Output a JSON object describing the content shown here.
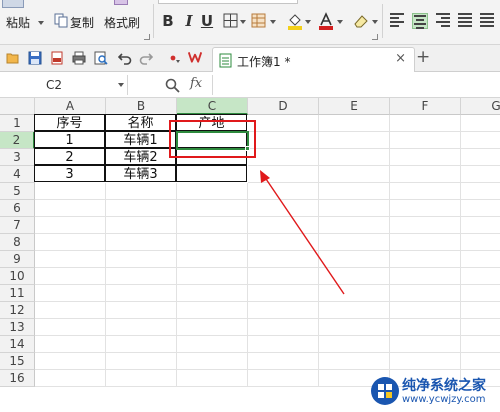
{
  "ribbon": {
    "paste_label": "粘贴",
    "copy_label": "复制",
    "format_painter_label": "格式刷",
    "bold_label": "B",
    "italic_label": "I",
    "underline_label": "U"
  },
  "tab": {
    "title": "工作簿1 *",
    "close": "×",
    "new": "+"
  },
  "formula_bar": {
    "cell_ref": "C2",
    "fx_label": "fx",
    "value": ""
  },
  "grid": {
    "columns": [
      "A",
      "B",
      "C",
      "D",
      "E",
      "F",
      "G"
    ],
    "rows": [
      "1",
      "2",
      "3",
      "4",
      "5",
      "6",
      "7",
      "8",
      "9",
      "10",
      "11",
      "12",
      "13",
      "14",
      "15",
      "16"
    ],
    "selected_column": "C",
    "selected_row": "2",
    "cells": {
      "A1": "序号",
      "B1": "名称",
      "C1": "产地",
      "A2": "1",
      "B2": "车辆1",
      "C2": "",
      "A3": "2",
      "B3": "车辆2",
      "C3": "",
      "A4": "3",
      "B4": "车辆3",
      "C4": ""
    }
  },
  "watermark": {
    "title": "纯净系统之家",
    "url": "www.ycwjzy.com"
  },
  "colors": {
    "selection": "#2e8b3e",
    "annotation": "#e0191b",
    "header_active": "#c6e6c6"
  }
}
